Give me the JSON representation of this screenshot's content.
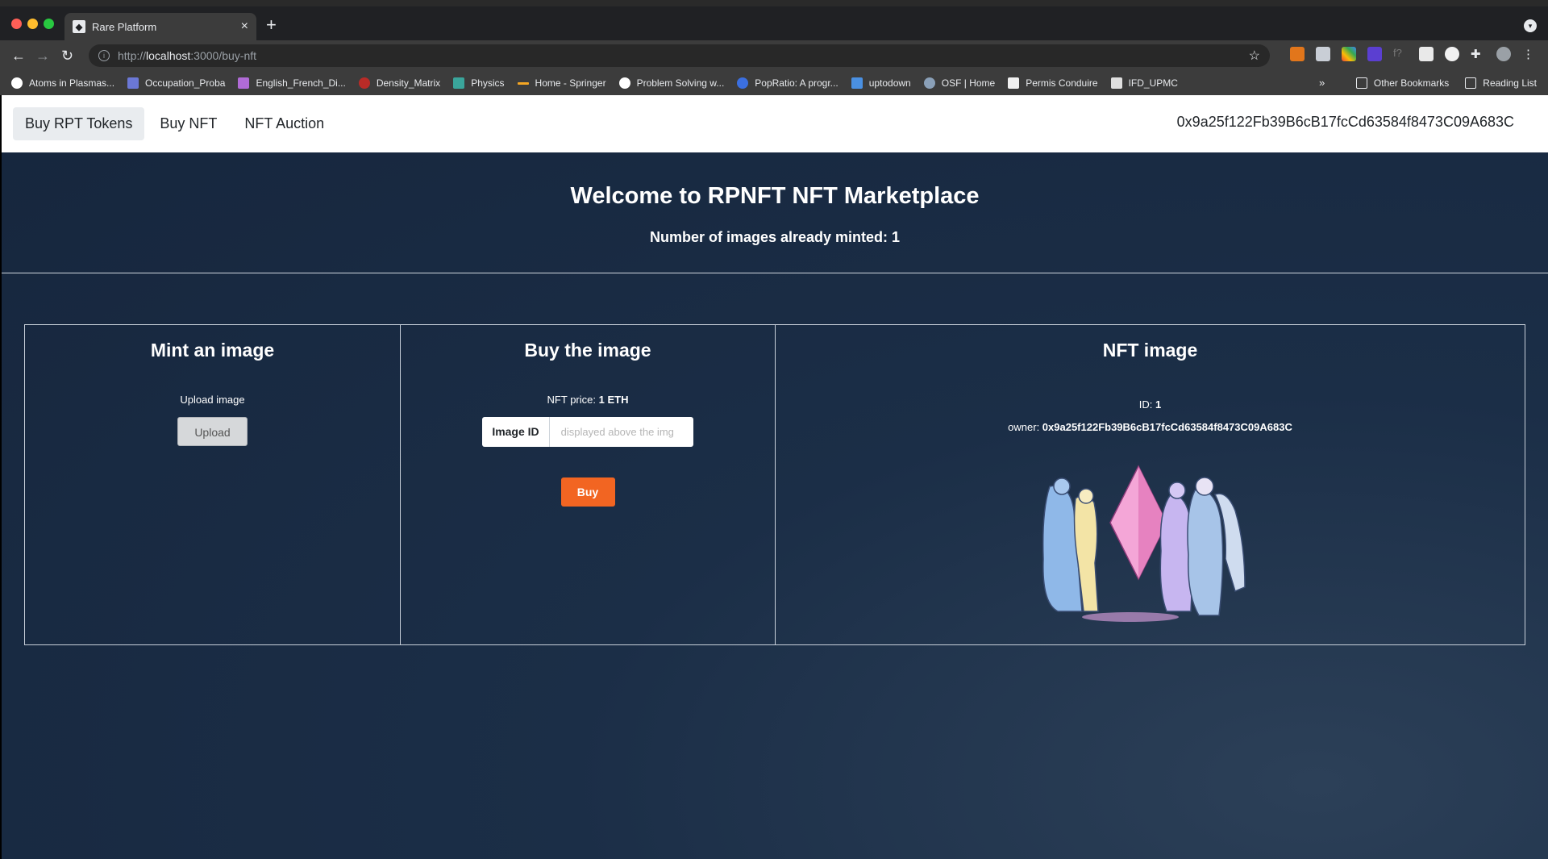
{
  "browser": {
    "tab_title": "Rare Platform",
    "url_scheme": "http://",
    "url_host": "localhost",
    "url_path": ":3000/buy-nft",
    "bookmarks": [
      "Atoms in Plasmas...",
      "Occupation_Proba",
      "English_French_Di...",
      "Density_Matrix",
      "Physics",
      "Home - Springer",
      "Problem Solving w...",
      "PopRatio: A progr...",
      "uptodown",
      "OSF | Home",
      "Permis Conduire",
      "IFD_UPMC"
    ],
    "other_bookmarks": "Other Bookmarks",
    "reading_list": "Reading List"
  },
  "nav": {
    "links": [
      "Buy RPT Tokens",
      "Buy NFT",
      "NFT Auction"
    ],
    "address": "0x9a25f122Fb39B6cB17fcCd63584f8473C09A683C"
  },
  "hero": {
    "title": "Welcome to RPNFT NFT Marketplace",
    "minted_text": "Number of images already minted: 1"
  },
  "mint": {
    "title": "Mint an image",
    "upload_label": "Upload image",
    "upload_button": "Upload"
  },
  "buy": {
    "title": "Buy the image",
    "price_label": "NFT price: ",
    "price_value": "1 ETH",
    "input_prefix": "Image ID",
    "input_placeholder": "displayed above the img",
    "buy_button": "Buy"
  },
  "nft": {
    "title": "NFT image",
    "id_label": "ID: ",
    "id_value": "1",
    "owner_label": "owner: ",
    "owner_value": "0x9a25f122Fb39B6cB17fcCd63584f8473C09A683C"
  }
}
